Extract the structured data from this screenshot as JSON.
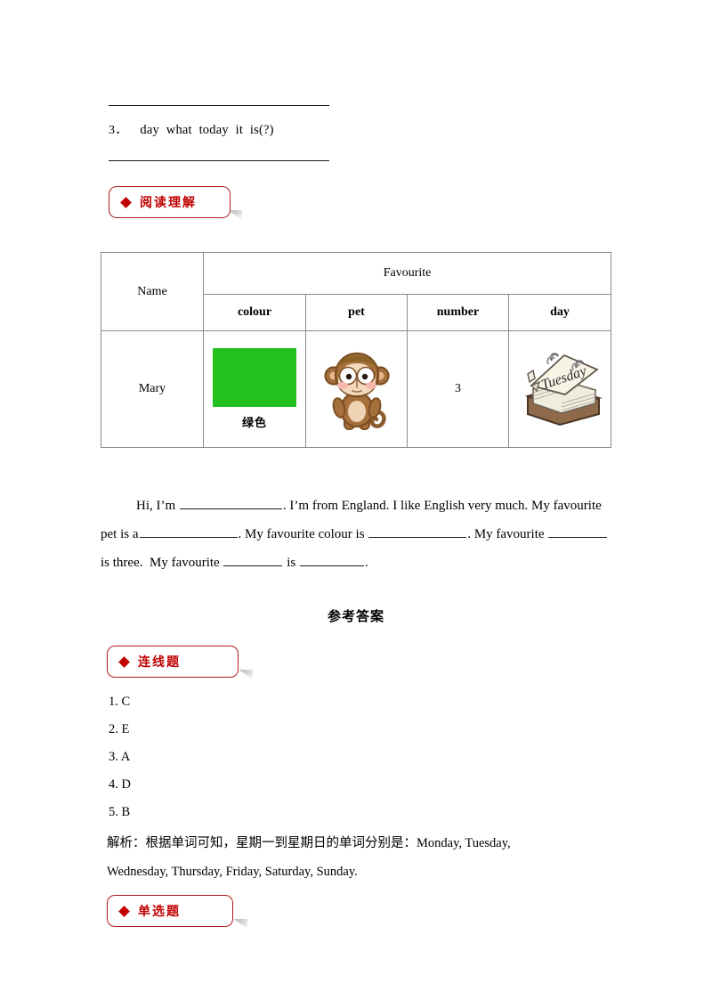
{
  "document": {
    "question3": {
      "number": "3．",
      "words": "day  what  today  it  is(?)"
    },
    "sections": [
      {
        "label": "阅读理解"
      },
      {
        "label": "连线题"
      },
      {
        "label": "单选题"
      }
    ],
    "table": {
      "name_header": "Name",
      "group_header": "Favourite",
      "sub_headers": [
        "colour",
        "pet",
        "number",
        "day"
      ],
      "row": {
        "name": "Mary",
        "colour_caption": "绿色",
        "colour_hex": "#22c11e",
        "pet": "monkey",
        "number": "3",
        "day": "Tuesday"
      }
    },
    "reading_paragraph": {
      "seg1": "Hi, I’m",
      "seg2": ". I’m from England. I like English very much. My",
      "seg3": "favourite pet is a",
      "seg4": ". My favourite colour is",
      "seg5": ". My",
      "seg6": "favourite",
      "seg7": "is three.",
      "seg8": "My favourite",
      "seg9": "is",
      "seg10": "."
    },
    "answers": {
      "title": "参考答案",
      "items": [
        "1. C",
        "2. E",
        "3. A",
        "4. D",
        "5. B"
      ],
      "explanation_line1": "解析：根据单词可知，星期一到星期日的单词分别是：Monday, Tuesday,",
      "explanation_line2": "Wednesday, Thursday, Friday, Saturday, Sunday."
    },
    "colors": {
      "badge_red": "#c00000",
      "badge_border": "#b11b1b",
      "table_border": "#8a8a8a"
    }
  }
}
